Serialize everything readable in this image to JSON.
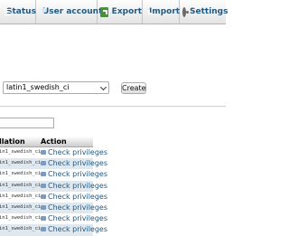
{
  "tabs": [
    {
      "label": "Status",
      "icon": "status-icon"
    },
    {
      "label": "User accounts",
      "icon": "users-icon"
    },
    {
      "label": "Export",
      "icon": "export-icon"
    },
    {
      "label": "Import",
      "icon": "import-icon"
    },
    {
      "label": "Settings",
      "icon": "settings-icon"
    }
  ],
  "create_db": {
    "collation_value": "latin1_swedish_ci",
    "create_label": "Create"
  },
  "filter": {
    "value": ""
  },
  "table": {
    "headers": [
      "llation",
      "Action"
    ],
    "rows": [
      {
        "collation": "in1_swedish_ci",
        "action": "Check privileges"
      },
      {
        "collation": "in1_swedish_ci",
        "action": "Check privileges"
      },
      {
        "collation": "in1_swedish_ci",
        "action": "Check privileges"
      },
      {
        "collation": "in1_swedish_ci",
        "action": "Check privileges"
      },
      {
        "collation": "in1_swedish_ci",
        "action": "Check privileges"
      },
      {
        "collation": "in1_swedish_ci",
        "action": "Check privileges"
      },
      {
        "collation": "in1_swedish_ci",
        "action": "Check privileges"
      },
      {
        "collation": "in1_swedish_ci",
        "action": "Check privileges"
      }
    ]
  },
  "colors": {
    "link": "#235a81",
    "row_alt": "#dfe8ef"
  }
}
